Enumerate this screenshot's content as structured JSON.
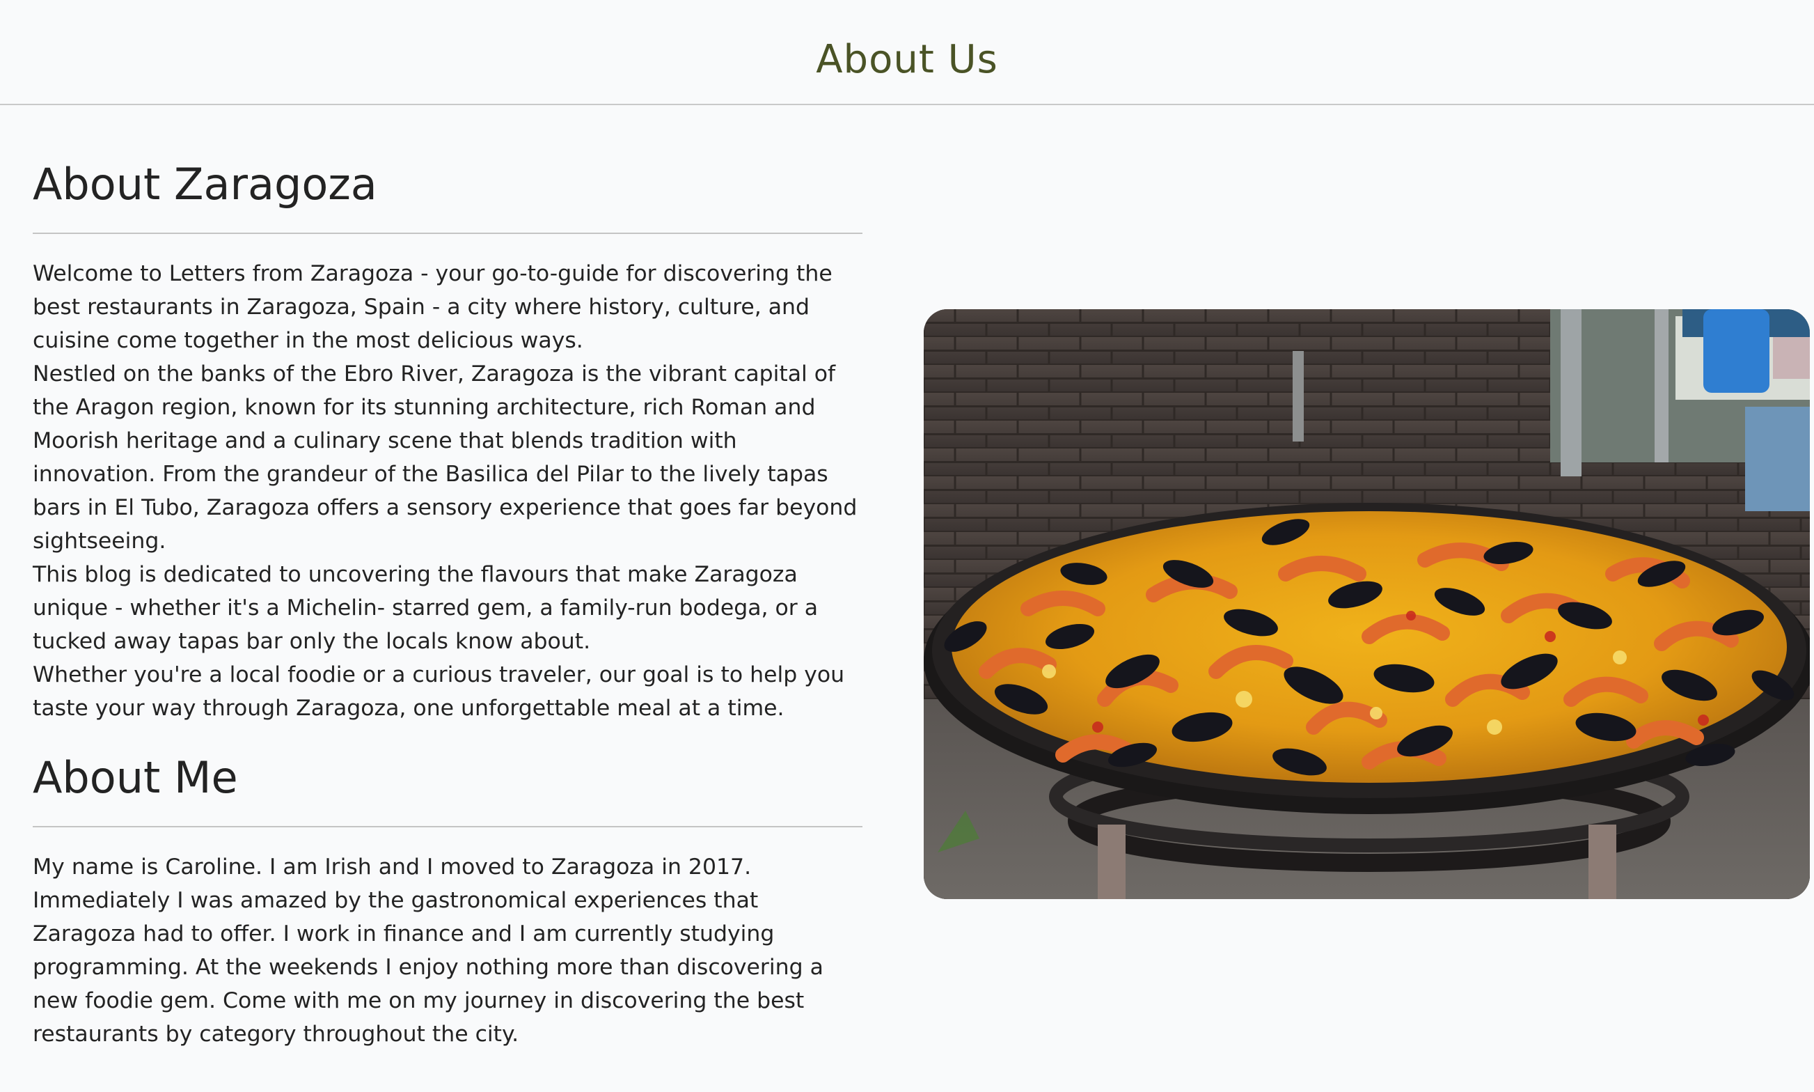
{
  "header": {
    "title": "About Us"
  },
  "about_zaragoza": {
    "heading": "About Zaragoza",
    "paragraphs": [
      "Welcome to Letters from Zaragoza - your go-to-guide for discovering the best restaurants in Zaragoza, Spain - a city where history, culture, and cuisine come together in the most delicious ways.",
      "Nestled on the banks of the Ebro River, Zaragoza is the vibrant capital of the Aragon region, known for its stunning architecture, rich Roman and Moorish heritage and a culinary scene that blends tradition with innovation. From the grandeur of the Basilica del Pilar to the lively tapas bars in El Tubo, Zaragoza offers a sensory experience that goes far beyond sightseeing.",
      "This blog is dedicated to uncovering the flavours that make Zaragoza unique - whether it's a Michelin- starred gem, a family-run bodega, or a tucked away tapas bar only the locals know about.",
      "Whether you're a local foodie or a curious traveler, our goal is to help you taste your way through Zaragoza, one unforgettable meal at a time."
    ]
  },
  "about_me": {
    "heading": "About Me",
    "paragraphs": [
      "My name is Caroline. I am Irish and I moved to Zaragoza in 2017. Immediately I was amazed by the gastronomical experiences that Zaragoza had to offer. I work in finance and I am currently studying programming. At the weekends I enjoy nothing more than discovering a new foodie gem. Come with me on my journey in discovering the best restaurants by category throughout the city."
    ]
  },
  "photo": {
    "icon": "paella-pan-image"
  },
  "colors": {
    "header_title": "#4a5326",
    "text": "#232323",
    "background": "#f9fafb",
    "rule": "#c4c4c4"
  }
}
